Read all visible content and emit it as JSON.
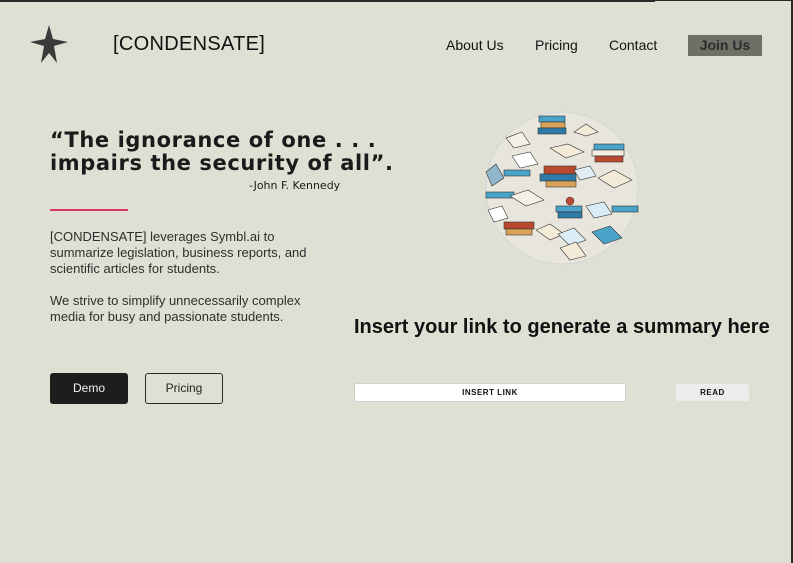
{
  "header": {
    "brand": "[CONDENSATE]",
    "logo_icon": "star-icon",
    "nav": {
      "about": "About Us",
      "pricing": "Pricing",
      "contact": "Contact"
    },
    "join_label": "Join Us"
  },
  "hero": {
    "quote": "“The ignorance of one . . . impairs the security of all”.",
    "author": "-John F. Kennedy",
    "paragraph1": "[CONDENSATE] leverages Symbl.ai to summarize legislation, business reports, and scientific articles for students.",
    "paragraph2": "We strive to simplify unnecessarily complex media for busy and passionate students.",
    "demo_label": "Demo",
    "pricing_label": "Pricing"
  },
  "illustration": {
    "icon": "books-illustration"
  },
  "summary": {
    "heading": "Insert your link to generate a summary here",
    "input_label": "INSERT LINK",
    "read_label": "READ"
  },
  "colors": {
    "background": "#dfdfd4",
    "accent": "#d6366a",
    "join_button": "#6f6f66",
    "demo_button": "#1d1d1d"
  }
}
